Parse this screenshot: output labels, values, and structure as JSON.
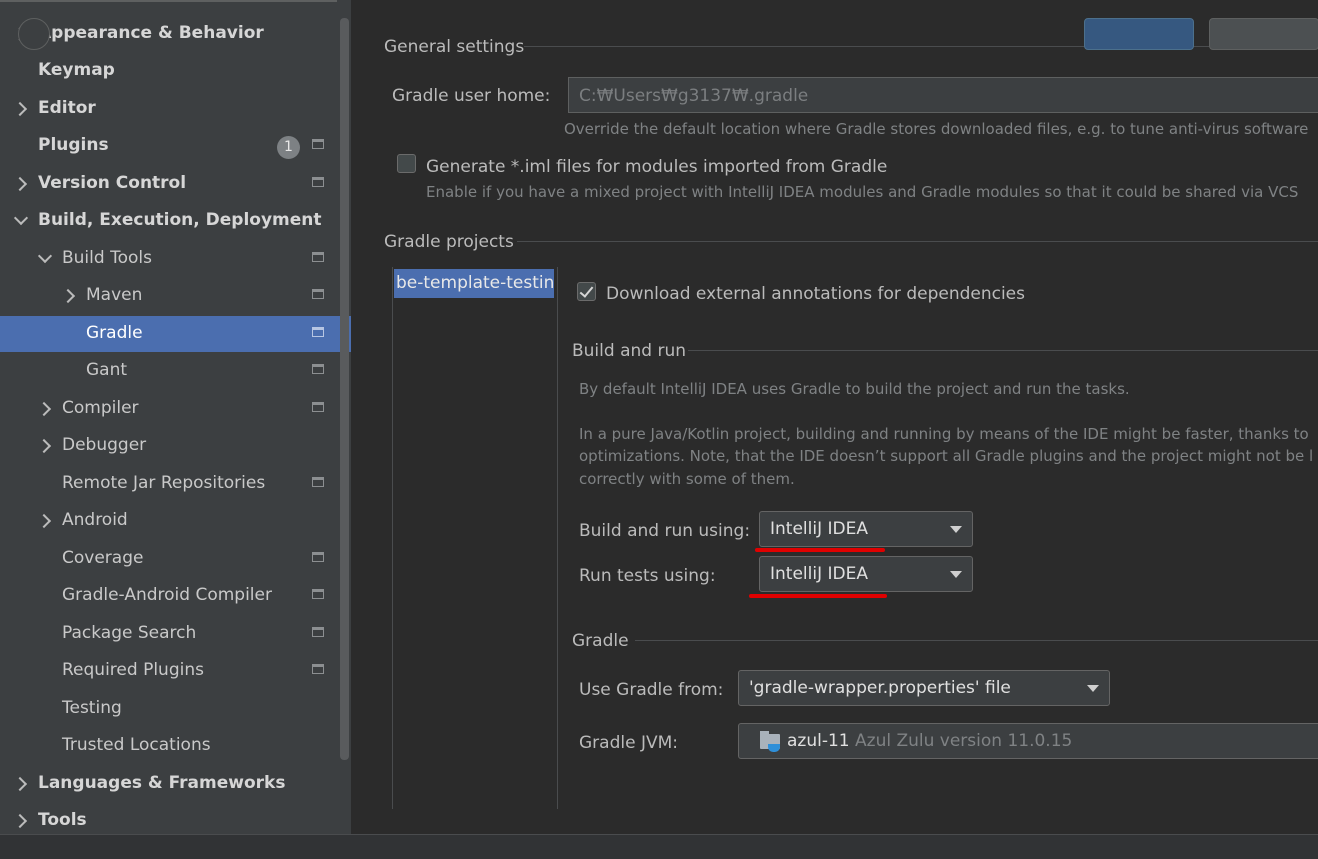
{
  "sidebar": {
    "items": [
      {
        "label": "Appearance & Behavior",
        "bold": true
      },
      {
        "label": "Keymap",
        "bold": true
      },
      {
        "label": "Editor",
        "bold": true
      },
      {
        "label": "Plugins",
        "bold": true,
        "badge": "1"
      },
      {
        "label": "Version Control",
        "bold": true
      },
      {
        "label": "Build, Execution, Deployment",
        "bold": true
      },
      {
        "label": "Build Tools"
      },
      {
        "label": "Maven"
      },
      {
        "label": "Gradle",
        "selected": true
      },
      {
        "label": "Gant"
      },
      {
        "label": "Compiler"
      },
      {
        "label": "Debugger"
      },
      {
        "label": "Remote Jar Repositories"
      },
      {
        "label": "Android"
      },
      {
        "label": "Coverage"
      },
      {
        "label": "Gradle-Android Compiler"
      },
      {
        "label": "Package Search"
      },
      {
        "label": "Required Plugins"
      },
      {
        "label": "Testing"
      },
      {
        "label": "Trusted Locations"
      },
      {
        "label": "Languages & Frameworks",
        "bold": true
      },
      {
        "label": "Tools",
        "bold": true
      }
    ]
  },
  "general": {
    "title": "General settings",
    "user_home_label": "Gradle user home:",
    "user_home_value": "C:₩Users₩g3137₩.gradle",
    "user_home_hint": "Override the default location where Gradle stores downloaded files, e.g. to tune anti-virus software",
    "iml_label": "Generate *.iml files for modules imported from Gradle",
    "iml_hint": "Enable if you have a mixed project with IntelliJ IDEA modules and Gradle modules so that it could be shared via VCS"
  },
  "projects": {
    "title": "Gradle projects",
    "selected_project": "be-template-testing",
    "download_annotations_label": "Download external annotations for dependencies"
  },
  "build_and_run": {
    "title": "Build and run",
    "desc1": "By default IntelliJ IDEA uses Gradle to build the project and run the tasks.",
    "desc2_line1": "In a pure Java/Kotlin project, building and running by means of the IDE might be faster, thanks to",
    "desc2_line2": "optimizations. Note, that the IDE doesn’t support all Gradle plugins and the project might not be l",
    "desc2_line3": "correctly with some of them.",
    "build_run_using_label": "Build and run using:",
    "build_run_using_value": "IntelliJ IDEA",
    "run_tests_using_label": "Run tests using:",
    "run_tests_using_value": "IntelliJ IDEA"
  },
  "gradle": {
    "title": "Gradle",
    "use_from_label": "Use Gradle from:",
    "use_from_value": "'gradle-wrapper.properties' file",
    "jvm_label": "Gradle JVM:",
    "jvm_name": "azul-11",
    "jvm_version": "Azul Zulu version 11.0.15"
  },
  "colors": {
    "selection": "#4b6eaf",
    "annotation_underline": "#e00000"
  }
}
